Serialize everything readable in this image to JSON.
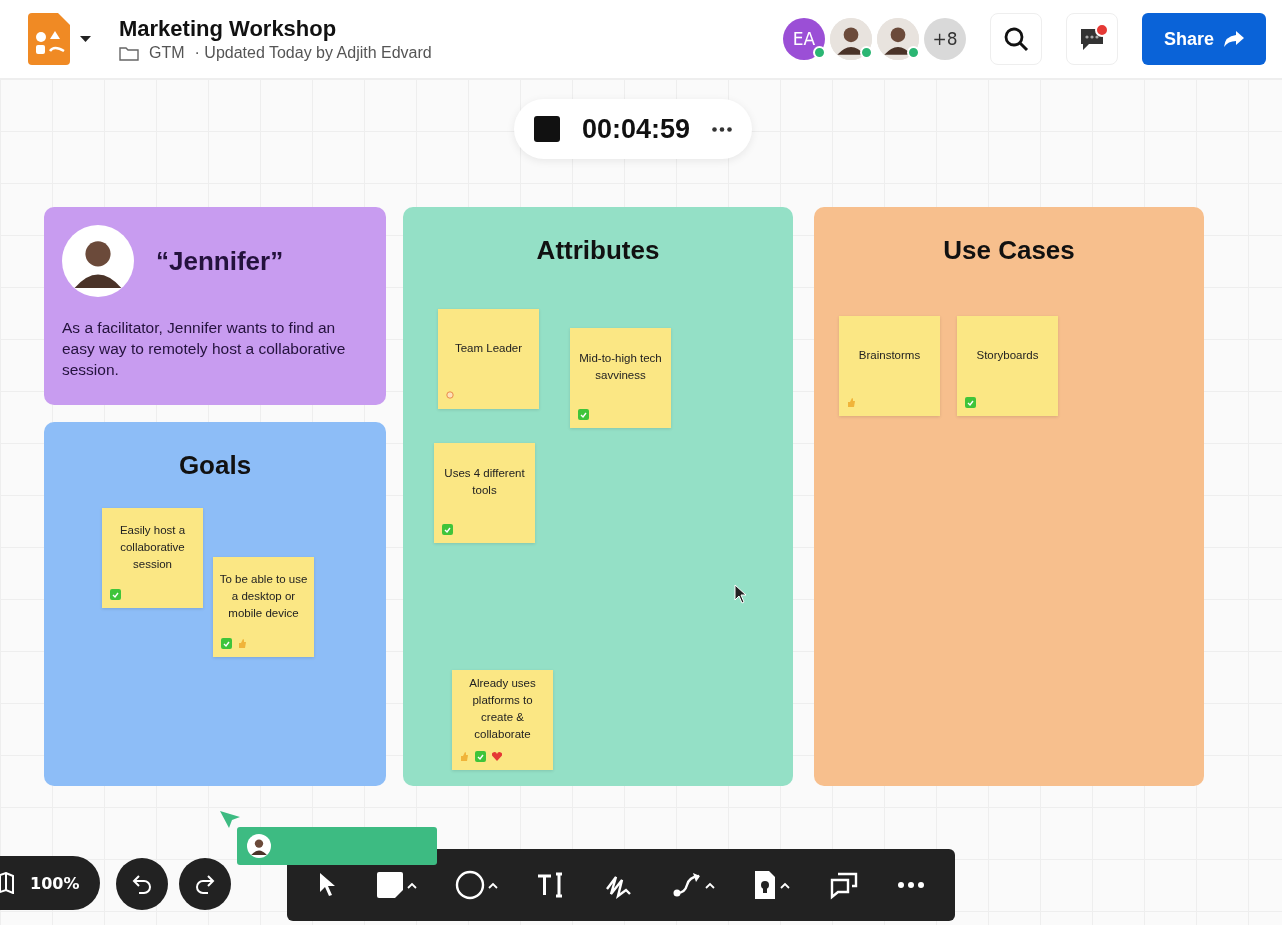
{
  "header": {
    "title": "Marketing Workshop",
    "folder": "GTM",
    "updated": "· Updated Today by Adjith Edvard",
    "collaborators": [
      {
        "kind": "initials",
        "text": "EA",
        "online": true
      },
      {
        "kind": "photo",
        "online": true
      },
      {
        "kind": "photo",
        "online": true
      },
      {
        "kind": "more",
        "text": "+8",
        "online": false
      }
    ],
    "chat": {
      "unread": true
    },
    "share_button": "Share"
  },
  "timer": {
    "time": "00:04:59"
  },
  "persona": {
    "name": "“Jennifer”",
    "description": "As a facilitator, Jennifer wants to find an easy way to remotely host a collaborative session."
  },
  "boards": [
    {
      "title": "Goals",
      "color": "#8dbdf7",
      "notes": [
        {
          "text": "Easily host a collaborative session",
          "reactions": [
            {
              "kind": "check"
            }
          ]
        },
        {
          "text": "To be able to use a desktop or mobile device",
          "reactions": [
            {
              "kind": "check"
            },
            {
              "kind": "thumb"
            }
          ]
        }
      ]
    },
    {
      "title": "Attributes",
      "color": "#94e0c6",
      "notes": [
        {
          "text": "Team Leader",
          "reactions": [
            {
              "kind": "dot"
            }
          ]
        },
        {
          "text": "Mid-to-high tech savviness",
          "reactions": [
            {
              "kind": "check"
            }
          ]
        },
        {
          "text": "Uses 4 different tools",
          "reactions": [
            {
              "kind": "check"
            }
          ]
        },
        {
          "text": "Already uses platforms to create & collaborate",
          "reactions": [
            {
              "kind": "thumb"
            },
            {
              "kind": "check"
            },
            {
              "kind": "heart"
            }
          ]
        }
      ]
    },
    {
      "title": "Use Cases",
      "color": "#f7bf8d",
      "notes": [
        {
          "text": "Brainstorms",
          "reactions": [
            {
              "kind": "thumb"
            }
          ]
        },
        {
          "text": "Storyboards",
          "reactions": [
            {
              "kind": "check"
            }
          ]
        }
      ]
    }
  ],
  "zoom": "100%",
  "tools": [
    {
      "kind": "select",
      "has_menu": false
    },
    {
      "kind": "rectangle",
      "has_menu": true
    },
    {
      "kind": "ellipse",
      "has_menu": true
    },
    {
      "kind": "text",
      "has_menu": false
    },
    {
      "kind": "pen",
      "has_menu": false
    },
    {
      "kind": "connector",
      "has_menu": true
    },
    {
      "kind": "sticker",
      "has_menu": true
    },
    {
      "kind": "comment",
      "has_menu": false
    },
    {
      "kind": "more",
      "has_menu": false
    }
  ]
}
